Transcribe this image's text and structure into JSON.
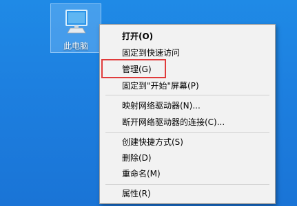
{
  "desktop": {
    "icon": {
      "label": "此电脑",
      "icon_name": "this-pc-icon"
    }
  },
  "context_menu": {
    "items": [
      {
        "label": "打开(O)",
        "bold": true
      },
      {
        "label": "固定到快速访问"
      },
      {
        "label": "管理(G)"
      },
      {
        "label": "固定到\"开始\"屏幕(P)"
      },
      {
        "label": "映射网络驱动器(N)..."
      },
      {
        "label": "断开网络驱动器的连接(C)..."
      },
      {
        "label": "创建快捷方式(S)"
      },
      {
        "label": "删除(D)"
      },
      {
        "label": "重命名(M)"
      },
      {
        "label": "属性(R)"
      }
    ]
  },
  "colors": {
    "desktop_background": "#1d7fdf",
    "menu_background": "#f2f2f2",
    "highlight_border": "#e03b3b"
  }
}
